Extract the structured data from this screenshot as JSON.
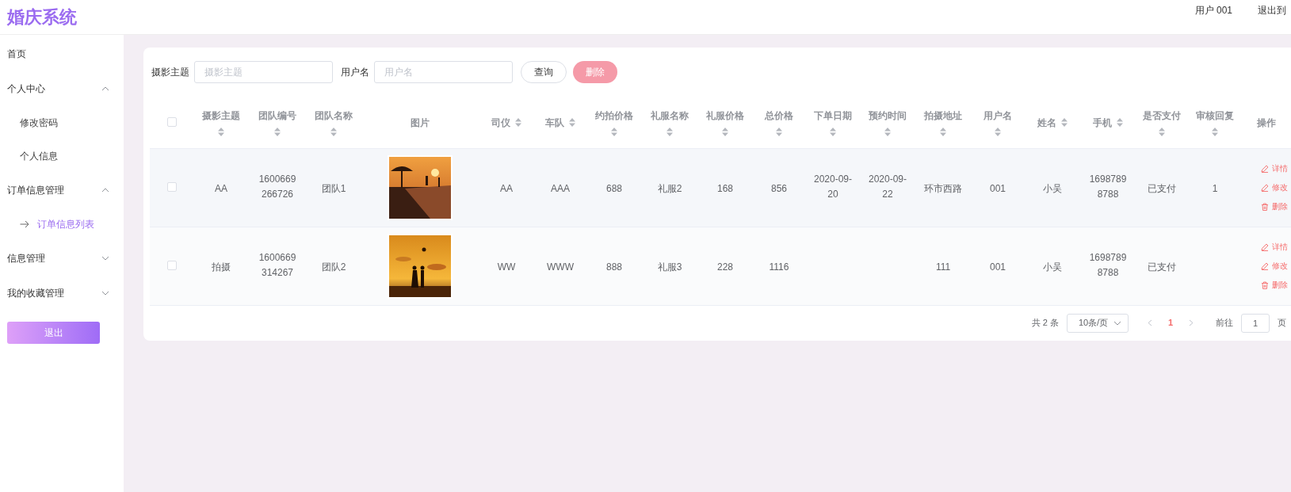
{
  "app_title": "婚庆系统",
  "header": {
    "user": "用户 001",
    "logout": "退出到"
  },
  "sidebar": {
    "items": [
      {
        "label": "首页",
        "selected": false
      },
      {
        "label": "个人中心",
        "selected": false,
        "expanded": true,
        "children": [
          {
            "label": "修改密码",
            "selected": false
          },
          {
            "label": "个人信息",
            "selected": false
          }
        ]
      },
      {
        "label": "订单信息管理",
        "selected": false,
        "expanded": true,
        "children": [
          {
            "label": "订单信息列表",
            "selected": true
          }
        ]
      },
      {
        "label": "信息管理",
        "selected": false,
        "expanded": false
      },
      {
        "label": "我的收藏管理",
        "selected": false,
        "expanded": false
      }
    ],
    "logout_button": "退出"
  },
  "search": {
    "fields": [
      {
        "label": "摄影主题",
        "placeholder": "摄影主题"
      },
      {
        "label": "用户名",
        "placeholder": "用户名"
      }
    ],
    "query_button": "查询",
    "delete_button": {
      "label": "删除",
      "disabled": true
    }
  },
  "table": {
    "select_all": false,
    "columns": [
      {
        "label": "摄影主题",
        "sortable": true
      },
      {
        "label": "团队编号",
        "sortable": true
      },
      {
        "label": "团队名称",
        "sortable": true
      },
      {
        "label": "图片",
        "sortable": false
      },
      {
        "label": "司仪",
        "sortable": true
      },
      {
        "label": "车队",
        "sortable": true
      },
      {
        "label": "约拍价格",
        "sortable": true
      },
      {
        "label": "礼服名称",
        "sortable": true
      },
      {
        "label": "礼服价格",
        "sortable": true
      },
      {
        "label": "总价格",
        "sortable": true
      },
      {
        "label": "下单日期",
        "sortable": true
      },
      {
        "label": "预约时间",
        "sortable": true
      },
      {
        "label": "拍摄地址",
        "sortable": true
      },
      {
        "label": "用户名",
        "sortable": true
      },
      {
        "label": "姓名",
        "sortable": true
      },
      {
        "label": "手机",
        "sortable": true
      },
      {
        "label": "是否支付",
        "sortable": true
      },
      {
        "label": "审核回复",
        "sortable": true
      },
      {
        "label": "操作",
        "sortable": false
      }
    ],
    "rows": [
      {
        "selected": false,
        "cells": [
          {
            "text": "AA"
          },
          {
            "text": "1600669266726"
          },
          {
            "text": "团队1"
          },
          {
            "kind": "picture"
          },
          {
            "text": "AA"
          },
          {
            "text": "AAA"
          },
          {
            "text": "688"
          },
          {
            "text": "礼服2"
          },
          {
            "text": "168"
          },
          {
            "text": "856"
          },
          {
            "text": "2020-09-20"
          },
          {
            "text": "2020-09-22"
          },
          {
            "text": "环市西路"
          },
          {
            "text": "001"
          },
          {
            "text": "小吴"
          },
          {
            "text": "16987898788"
          },
          {
            "text": "已支付"
          },
          {
            "text": "1"
          },
          {
            "actions": [
              {
                "kind": "edit",
                "label": "详情"
              },
              {
                "kind": "edit",
                "label": "修改"
              },
              {
                "kind": "delete",
                "label": "删除"
              }
            ]
          }
        ]
      },
      {
        "selected": false,
        "cells": [
          {
            "text": "拍摄"
          },
          {
            "text": "1600669314267"
          },
          {
            "text": "团队2"
          },
          {
            "kind": "picture"
          },
          {
            "text": "WW"
          },
          {
            "text": "WWW"
          },
          {
            "text": "888"
          },
          {
            "text": "礼服3"
          },
          {
            "text": "228"
          },
          {
            "text": "1116"
          },
          {},
          {},
          {
            "text": "111"
          },
          {
            "text": "001"
          },
          {
            "text": "小吴"
          },
          {
            "text": "16987898788"
          },
          {
            "text": "已支付"
          },
          {},
          {
            "actions": [
              {
                "kind": "edit",
                "label": "详情"
              },
              {
                "kind": "edit",
                "label": "修改"
              },
              {
                "kind": "delete",
                "label": "删除"
              }
            ]
          }
        ]
      }
    ]
  },
  "pagination": {
    "total": "共 2 条",
    "page_size": "10条/页",
    "pages": [
      {
        "label": "1",
        "selected": true
      }
    ],
    "goto_label": "前往",
    "goto_value": "1",
    "goto_suffix": "页"
  }
}
